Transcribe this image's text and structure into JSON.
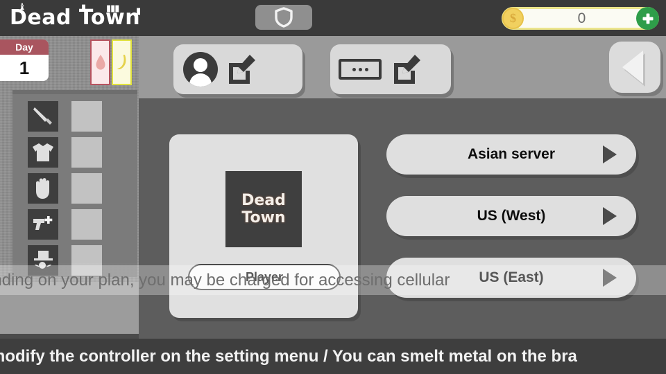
{
  "header": {
    "logo_text": "Dead Town",
    "shield_icon": "shield-icon",
    "currency": {
      "coin_icon": "coin-icon",
      "amount": "0",
      "add_label": "+"
    }
  },
  "hud": {
    "day_label": "Day",
    "day_value": "1",
    "gauges": [
      {
        "name": "water-gauge",
        "icon": "water-drop-icon",
        "color": "#b6535f",
        "fill": "#fbe9ea"
      },
      {
        "name": "food-gauge",
        "icon": "banana-icon",
        "color": "#e1e23c",
        "fill": "#fbfade"
      }
    ]
  },
  "inventory": {
    "slots": [
      {
        "icon": "knife-icon"
      },
      {
        "icon": "shirt-icon"
      },
      {
        "icon": "hand-icon"
      },
      {
        "icon": "gun-add-icon"
      },
      {
        "icon": "hat-character-icon"
      }
    ]
  },
  "toolbar": {
    "buttons": [
      {
        "name": "avatar-edit-button",
        "icon": "avatar-icon",
        "edit_icon": "edit-pencil-icon"
      },
      {
        "name": "nickname-edit-button",
        "icon": "nameplate-icon",
        "edit_icon": "edit-pencil-icon"
      }
    ],
    "back_button": {
      "name": "back-button",
      "icon": "back-triangle-icon"
    }
  },
  "player_card": {
    "logo_line1": "Dead",
    "logo_line2": "Town",
    "player_button_label": "Player"
  },
  "servers": {
    "items": [
      {
        "label": "Asian server",
        "arrow": "play-arrow-icon"
      },
      {
        "label": "US (West)",
        "arrow": "play-arrow-icon"
      },
      {
        "label": "US (East)",
        "arrow": "play-arrow-icon"
      }
    ]
  },
  "notice": {
    "text": "ending on your plan, you may be charged for accessing cellular"
  },
  "ticker": {
    "text": "modify the controller on the setting menu / You can smelt metal on the bra"
  },
  "colors": {
    "header_bg": "#3a3a3a",
    "panel_bg": "#5d5d5d",
    "button_bg": "#dfdfdf",
    "accent_gold": "#f1d05f",
    "accent_green": "#2e9d49",
    "day_red": "#a9555f"
  }
}
